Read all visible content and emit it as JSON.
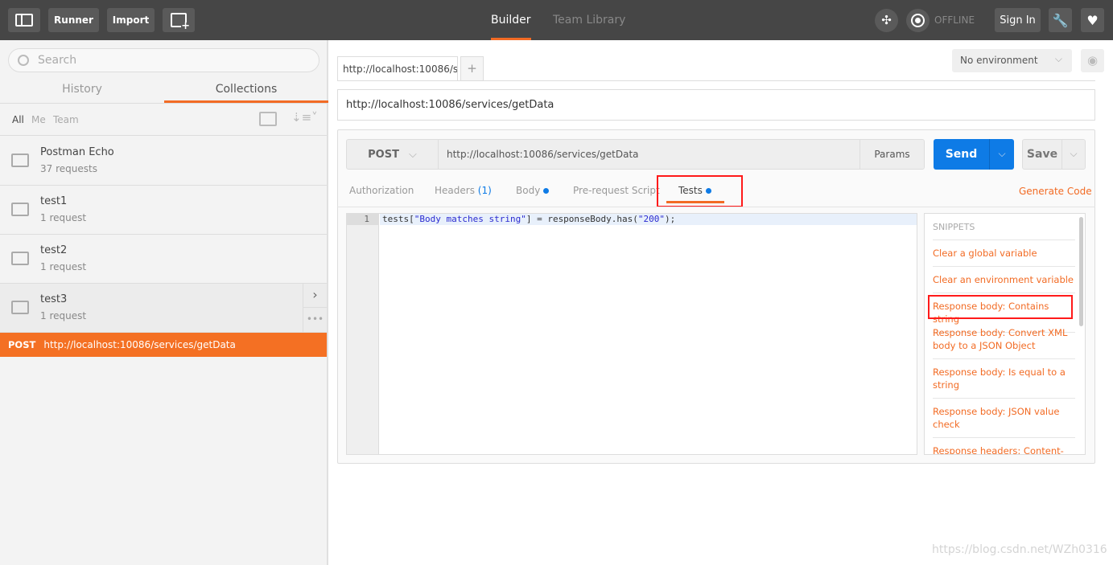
{
  "topbar": {
    "runner": "Runner",
    "import": "Import",
    "tabs": [
      {
        "label": "Builder",
        "active": true
      },
      {
        "label": "Team Library",
        "active": false
      }
    ],
    "offline": "OFFLINE",
    "sign_in": "Sign In"
  },
  "sidebar": {
    "search_placeholder": "Search",
    "tabs": [
      "History",
      "Collections"
    ],
    "active_tab": "Collections",
    "filters": [
      "All",
      "Me",
      "Team"
    ],
    "collections": [
      {
        "name": "Postman Echo",
        "count": "37 requests"
      },
      {
        "name": "test1",
        "count": "1 request"
      },
      {
        "name": "test2",
        "count": "1 request"
      },
      {
        "name": "test3",
        "count": "1 request"
      }
    ],
    "selected_request": {
      "method": "POST",
      "url": "http://localhost:10086/services/getData"
    }
  },
  "main": {
    "tab_label": "http://localhost:10086/s",
    "add_tab": "+",
    "environment": "No environment",
    "title_url": "http://localhost:10086/services/getData",
    "method": "POST",
    "url": "http://localhost:10086/services/getData",
    "params": "Params",
    "send": "Send",
    "save": "Save",
    "req_tabs": {
      "authorization": "Authorization",
      "headers": "Headers",
      "headers_count": "(1)",
      "body": "Body",
      "prerequest": "Pre-request Script",
      "tests": "Tests"
    },
    "generate_code": "Generate Code",
    "editor": {
      "line_number": "1",
      "code_parts": [
        "tests[",
        "\"Body matches string\"",
        "] = responseBody.has(",
        "\"200\"",
        ");"
      ]
    },
    "snippets_header": "SNIPPETS",
    "snippets": [
      "Clear a global variable",
      "Clear an environment variable",
      "Response body: Contains string",
      "Response body: Convert XML body to a JSON Object",
      "Response body: Is equal to a string",
      "Response body: JSON value check",
      "Response headers: Content-"
    ]
  },
  "watermark": "https://blog.csdn.net/WZh0316",
  "colors": {
    "accent": "#f26b24",
    "primary": "#0e7be6",
    "topbar": "#464646",
    "highlight_box": "#ff0000"
  }
}
